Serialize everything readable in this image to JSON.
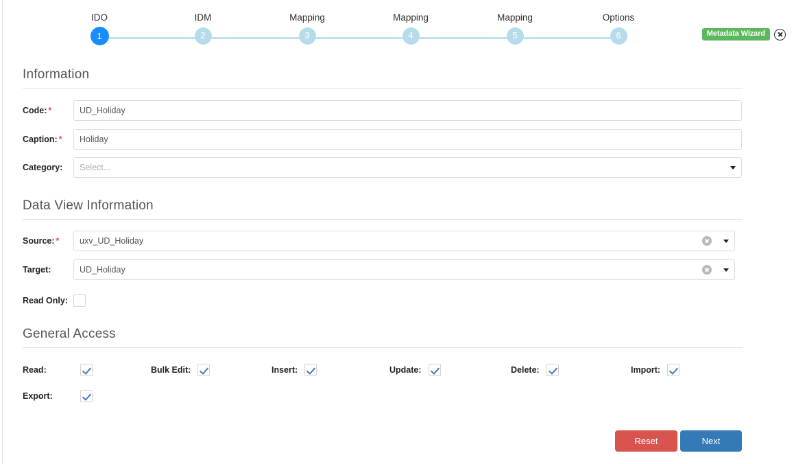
{
  "wizard": {
    "badge_label": "Metadata Wizard",
    "close_icon": "close-circle-icon"
  },
  "stepper": {
    "steps": [
      {
        "label": "IDO",
        "number": "1",
        "active": true
      },
      {
        "label": "IDM",
        "number": "2",
        "active": false
      },
      {
        "label": "Mapping",
        "number": "3",
        "active": false
      },
      {
        "label": "Mapping",
        "number": "4",
        "active": false
      },
      {
        "label": "Mapping",
        "number": "5",
        "active": false
      },
      {
        "label": "Options",
        "number": "6",
        "active": false
      }
    ],
    "active_color": "#1a8cff",
    "inactive_color": "#b6dcec"
  },
  "information": {
    "title": "Information",
    "code": {
      "label": "Code:",
      "required": "*",
      "value": "UD_Holiday"
    },
    "caption": {
      "label": "Caption:",
      "required": "*",
      "value": "Holiday"
    },
    "category": {
      "label": "Category:",
      "placeholder": "Select...",
      "value": ""
    }
  },
  "data_view": {
    "title": "Data View Information",
    "source": {
      "label": "Source:",
      "required": "*",
      "value": "uxv_UD_Holiday"
    },
    "target": {
      "label": "Target:",
      "value": "UD_Holiday"
    },
    "read_only": {
      "label": "Read Only:",
      "checked": false
    }
  },
  "general_access": {
    "title": "General Access",
    "items": [
      {
        "label": "Read:",
        "checked": true
      },
      {
        "label": "Bulk Edit:",
        "checked": true
      },
      {
        "label": "Insert:",
        "checked": true
      },
      {
        "label": "Update:",
        "checked": true
      },
      {
        "label": "Delete:",
        "checked": true
      },
      {
        "label": "Import:",
        "checked": true
      },
      {
        "label": "Export:",
        "checked": true
      }
    ]
  },
  "footer": {
    "reset_label": "Reset",
    "next_label": "Next",
    "reset_color": "#d9534f",
    "next_color": "#337ab7"
  }
}
